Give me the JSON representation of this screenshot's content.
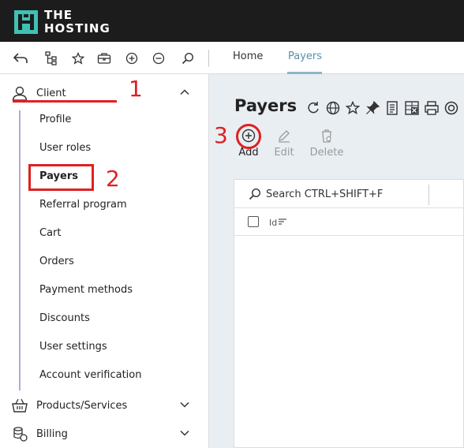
{
  "brand": {
    "line1": "THE",
    "line2": "HOSTING"
  },
  "toolbar": {
    "icons": [
      "back-icon",
      "tree-icon",
      "star-icon",
      "briefcase-icon",
      "plus-circle-icon",
      "minus-circle-icon",
      "search-icon"
    ],
    "tabs": [
      {
        "label": "Home",
        "active": false
      },
      {
        "label": "Payers",
        "active": true
      }
    ]
  },
  "sidebar": {
    "client_group": {
      "label": "Client",
      "icon": "user-icon",
      "expanded": true
    },
    "items": [
      {
        "label": "Profile"
      },
      {
        "label": "User roles"
      },
      {
        "label": "Payers"
      },
      {
        "label": "Referral program"
      },
      {
        "label": "Cart"
      },
      {
        "label": "Orders"
      },
      {
        "label": "Payment methods"
      },
      {
        "label": "Discounts"
      },
      {
        "label": "User settings"
      },
      {
        "label": "Account verification"
      }
    ],
    "products_group": {
      "label": "Products/Services",
      "icon": "basket-icon",
      "expanded": false
    },
    "billing_group": {
      "label": "Billing",
      "icon": "coins-icon",
      "expanded": false
    }
  },
  "main": {
    "title": "Payers",
    "title_icons": [
      "refresh-icon",
      "globe-icon",
      "star-icon",
      "pin-icon",
      "document-icon",
      "excel-icon",
      "print-icon",
      "help-icon"
    ],
    "actions": [
      {
        "label": "Add",
        "icon": "plus-circle-icon",
        "enabled": true
      },
      {
        "label": "Edit",
        "icon": "pencil-icon",
        "enabled": false
      },
      {
        "label": "Delete",
        "icon": "trash-icon",
        "enabled": false
      }
    ],
    "search": {
      "placeholder": "Search CTRL+SHIFT+F"
    },
    "table": {
      "columns": [
        "Id"
      ]
    }
  },
  "annotations": {
    "step1": "1",
    "step2": "2",
    "step3": "3",
    "color": "#e02020"
  }
}
